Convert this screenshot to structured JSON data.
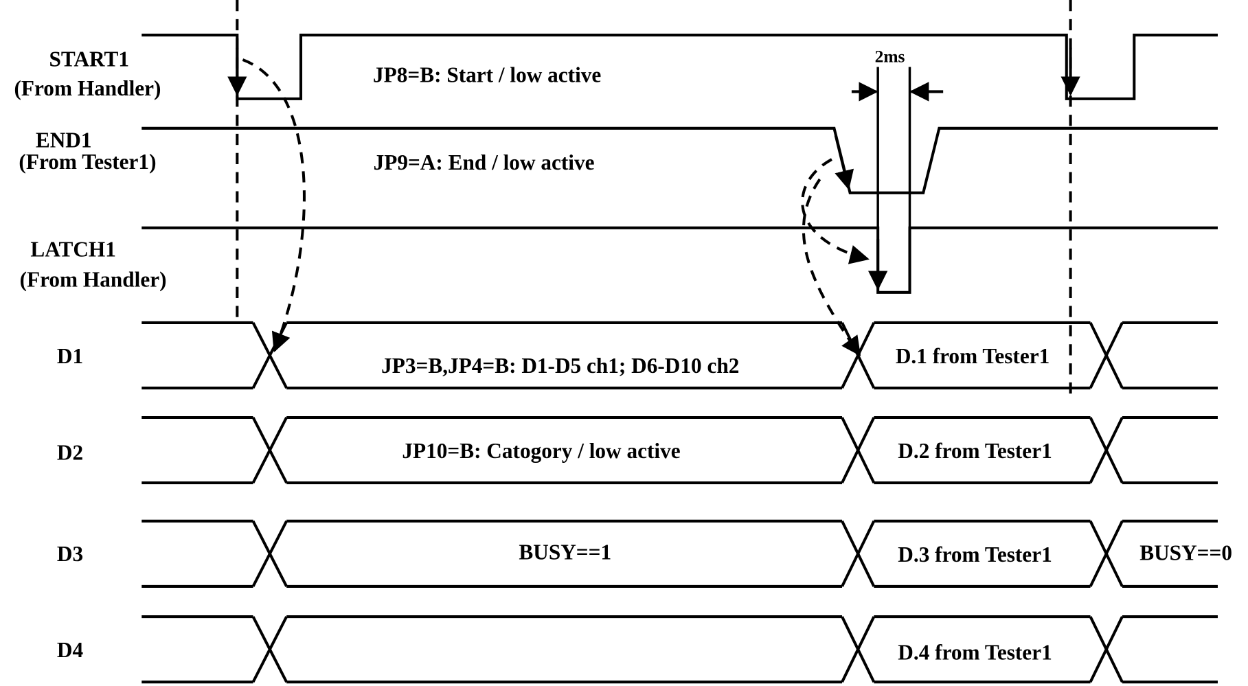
{
  "diagram": {
    "type": "timing-diagram",
    "signals": [
      {
        "name": "START1",
        "source": "(From Handler)",
        "note": "JP8=B: Start / low active"
      },
      {
        "name": "END1",
        "source": "(From Tester1)",
        "note": "JP9=A: End / low active"
      },
      {
        "name": "LATCH1",
        "source": "(From Handler)",
        "note": ""
      },
      {
        "name": "D1",
        "source": "",
        "note": "JP3=B,JP4=B: D1-D5 ch1; D6-D10 ch2",
        "data_label": "D.1 from Tester1",
        "after_label": ""
      },
      {
        "name": "D2",
        "source": "",
        "note": "JP10=B: Catogory / low active",
        "data_label": "D.2 from Tester1",
        "after_label": ""
      },
      {
        "name": "D3",
        "source": "",
        "note": "BUSY==1",
        "data_label": "D.3 from Tester1",
        "after_label": "BUSY==0"
      },
      {
        "name": "D4",
        "source": "",
        "note": "",
        "data_label": "D.4 from Tester1",
        "after_label": ""
      }
    ],
    "pulse_width_label": "2ms"
  }
}
